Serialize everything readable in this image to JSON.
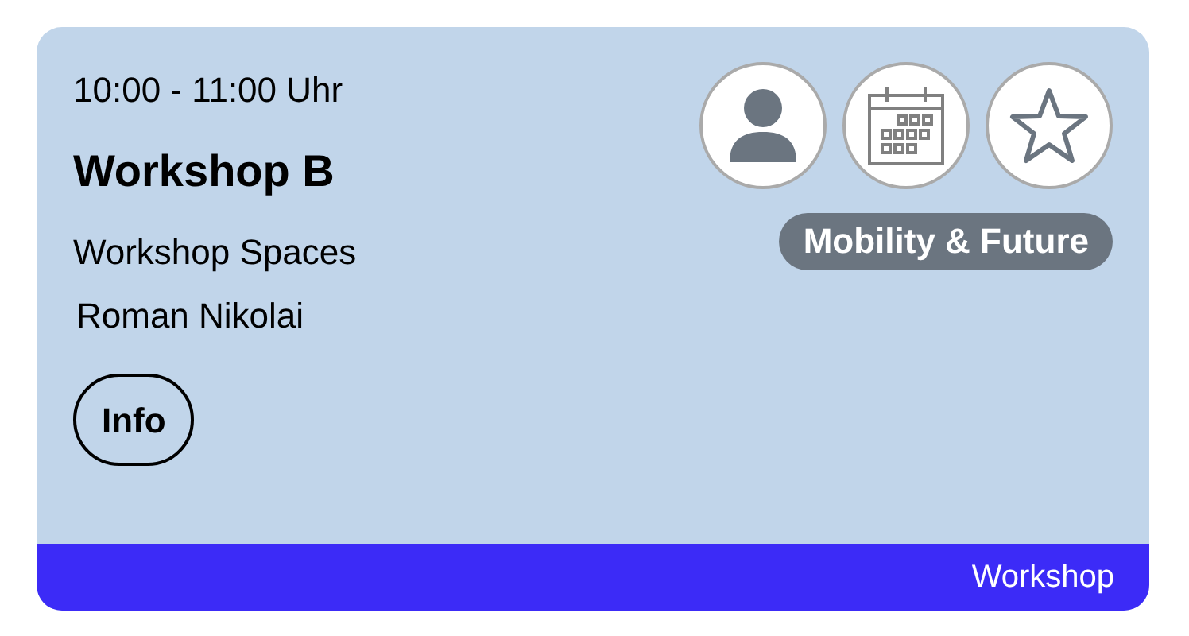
{
  "time": "10:00 - 11:00 Uhr",
  "title": "Workshop B",
  "location": "Workshop Spaces",
  "speaker": "Roman Nikolai",
  "info_button": "Info",
  "favorite": false,
  "track": "Mobility & Future",
  "category": "Workshop"
}
